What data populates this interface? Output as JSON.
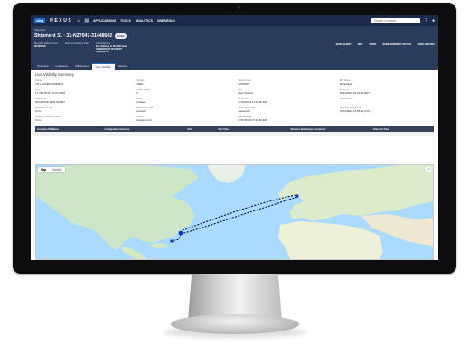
{
  "app": {
    "logo": "xdog",
    "brand": "NEXUS",
    "nav": [
      "APPLICATIONS",
      "TOOLS",
      "ANALYTICS",
      "ONE NEXUS"
    ],
    "search_placeholder": "Search in Nexus"
  },
  "header": {
    "breadcrumb": "Shipments",
    "title": "Shipment 31 · 31-NZ7047-31448602",
    "status": "Active",
    "meta": [
      {
        "label": "Required Delivery Date",
        "value": "08/10/2018"
      },
      {
        "label": "Shipment Delivery Date",
        "value": ""
      },
      {
        "label": "Last Milestone",
        "value": "Est. Delivery to BL4000 Gate"
      }
    ],
    "meta_extra": [
      "06/28/2018 17:30:00 EDT",
      "Antwerp, BE"
    ],
    "actions": [
      "SEND QUERY",
      "EDIT",
      "PRINT",
      "SEND SHIPMENT NOTICE",
      "VIEW HISTORY"
    ]
  },
  "tabs": [
    "Overview",
    "Line Items",
    "Milestones",
    "Live Visibility",
    "History"
  ],
  "active_tab": "Live Visibility",
  "summary": {
    "title": "Live Visibility Summary",
    "fields": [
      {
        "label": "Vessel",
        "value": "YM LEADER EXPRESS"
      },
      {
        "label": "Voyage",
        "value": "120E"
      },
      {
        "label": "Vessel Code",
        "value": "9234768"
      },
      {
        "label": "ECI Status",
        "value": "Scheduled"
      },
      {
        "label": "GPS",
        "value": "17.76N 87.8 / 07-27-2018"
      },
      {
        "label": "Latest Speed",
        "value": "0"
      },
      {
        "label": "POL",
        "value": "New Orleans"
      },
      {
        "label": "ETD POL",
        "value": "06/21/2018 02:01:00 EDT"
      },
      {
        "label": "Actual POL",
        "value": "06/21/2018 11:32:00 EDT"
      },
      {
        "label": "POD",
        "value": "Antwerp"
      },
      {
        "label": "ETD POD",
        "value": "07/10/2018 17:00:00 EDT"
      },
      {
        "label": "Actual POD",
        "value": ""
      },
      {
        "label": "Distance to POD",
        "value": "0 nm"
      },
      {
        "label": "Last Port of Call",
        "value": "Houston"
      },
      {
        "label": "Next Port of Call",
        "value": "Savannah"
      },
      {
        "label": "Next Port of Call ETA",
        "value": "07/07/2018 10:58:34 UTC"
      },
      {
        "label": "Distance - Vessel to NPoC",
        "value": "0 nm"
      },
      {
        "label": "Carrier",
        "value": "Hapag Lloyd"
      },
      {
        "label": "Last Updated",
        "value": "07/27/2018 07:10:22 EDT"
      },
      {
        "label": "",
        "value": ""
      }
    ]
  },
  "table": {
    "columns": [
      "Container Bill Name",
      "Configuration Outcome",
      "Unit",
      "Port Type",
      "Distance Remaining to Goalzone",
      "Date and Time"
    ],
    "empty": "· · ·"
  },
  "map": {
    "tabs": [
      "Map",
      "Satellite"
    ],
    "active_tab": "Map",
    "fullscreen_icon": "fullscreen-icon"
  }
}
